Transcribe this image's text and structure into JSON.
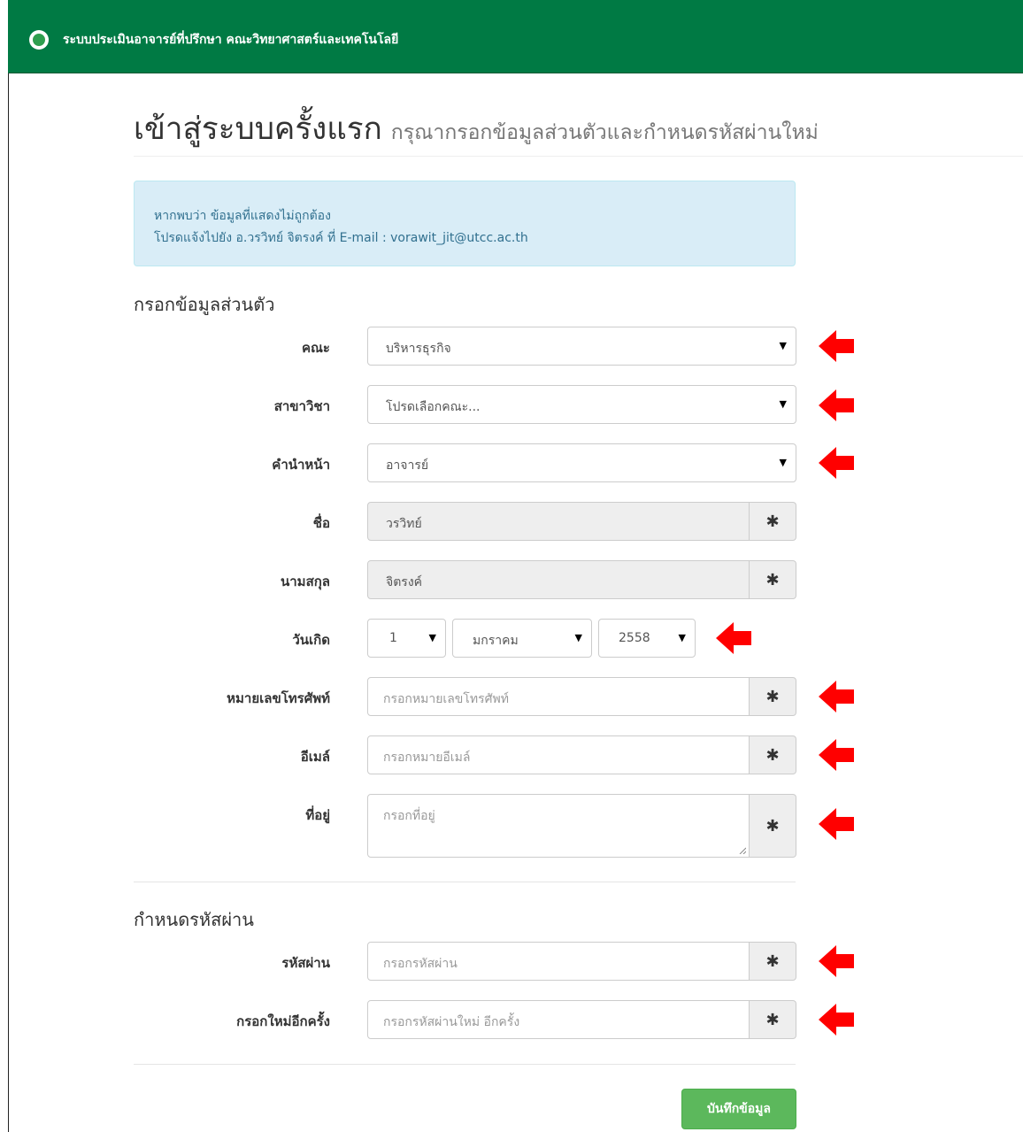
{
  "navbar": {
    "title": "ระบบประเมินอาจารย์ที่ปรึกษา คณะวิทยาศาสตร์และเทคโนโลยี"
  },
  "page": {
    "title": "เข้าสู่ระบบครั้งแรก",
    "subtitle": "กรุณากรอกข้อมูลส่วนตัวและกำหนดรหัสผ่านใหม่"
  },
  "alert": {
    "line1": "หากพบว่า ข้อมูลที่แสดงไม่ถูกต้อง",
    "line2": "โปรดแจ้งไปยัง อ.วรวิทย์ จิตรงค์ ที่ E-mail : vorawit_jit@utcc.ac.th"
  },
  "personal": {
    "heading": "กรอกข้อมูลส่วนตัว",
    "faculty": {
      "label": "คณะ",
      "value": "บริหารธุรกิจ"
    },
    "major": {
      "label": "สาขาวิชา",
      "value": "โปรดเลือกคณะ..."
    },
    "prefix": {
      "label": "คำนำหน้า",
      "value": "อาจารย์"
    },
    "firstname": {
      "label": "ชื่อ",
      "value": "วรวิทย์"
    },
    "lastname": {
      "label": "นามสกุล",
      "value": "จิตรงค์"
    },
    "birthdate": {
      "label": "วันเกิด",
      "day": "1",
      "month": "มกราคม",
      "year": "2558"
    },
    "phone": {
      "label": "หมายเลขโทรศัพท์",
      "placeholder": "กรอกหมายเลขโทรศัพท์"
    },
    "email": {
      "label": "อีเมล์",
      "placeholder": "กรอกหมายอีเมล์"
    },
    "address": {
      "label": "ที่อยู่",
      "placeholder": "กรอกที่อยู่"
    }
  },
  "password": {
    "heading": "กำหนดรหัสผ่าน",
    "pass": {
      "label": "รหัสผ่าน",
      "placeholder": "กรอกรหัสผ่าน"
    },
    "confirm": {
      "label": "กรอกใหม่อีกครั้ง",
      "placeholder": "กรอกรหัสผ่านใหม่ อีกครั้ง"
    }
  },
  "buttons": {
    "save": "บันทึกข้อมูล"
  },
  "icons": {
    "required": "asterisk-icon",
    "annotation": "red-arrow-icon",
    "caret": "caret-down-icon"
  },
  "colors": {
    "navbar": "#007a44",
    "alert_bg": "#d9edf7",
    "save_button": "#5cb85c",
    "arrow": "#ff0000"
  }
}
